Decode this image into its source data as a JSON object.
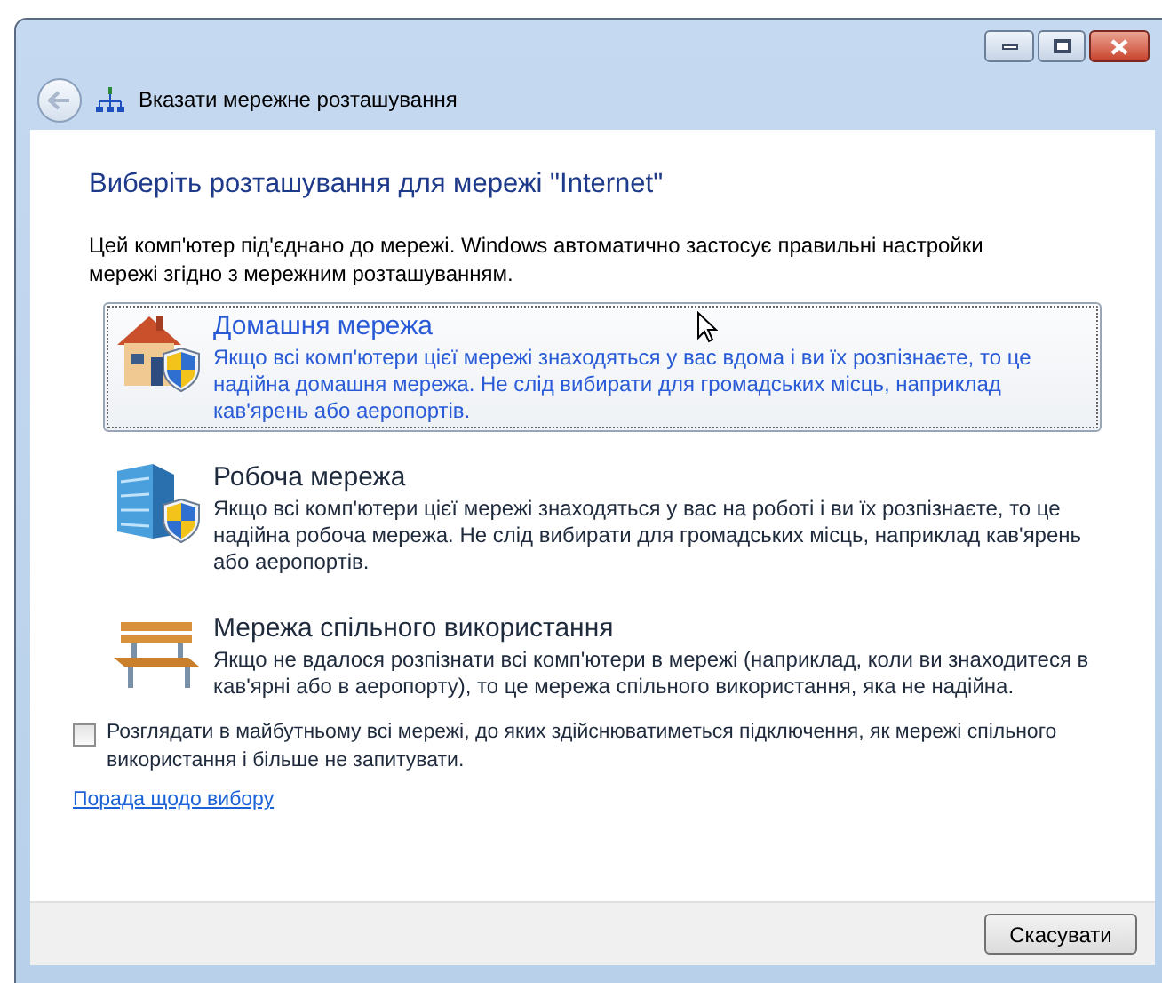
{
  "window": {
    "title": "Вказати мережне розташування"
  },
  "heading": "Виберіть розташування для мережі \"Internet\"",
  "intro": "Цей комп'ютер під'єднано до мережі. Windows автоматично застосує правильні настройки мережі згідно з мережним розташуванням.",
  "options": [
    {
      "kind": "home",
      "title": "Домашня мережа",
      "description": "Якщо всі комп'ютери цієї мережі знаходяться у вас вдома і ви їх розпізнаєте, то це надійна домашня мережа. Не слід вибирати для громадських місць, наприклад кав'ярень або аеропортів.",
      "selected": true
    },
    {
      "kind": "work",
      "title": "Робоча мережа",
      "description": "Якщо всі комп'ютери цієї мережі знаходяться у вас на роботі і ви їх розпізнаєте, то це надійна робоча мережа. Не слід вибирати для громадських місць, наприклад кав'ярень або аеропортів.",
      "selected": false
    },
    {
      "kind": "public",
      "title": "Мережа спільного використання",
      "description": "Якщо не вдалося розпізнати всі комп'ютери в мережі (наприклад, коли ви знаходитеся в кав'ярні або в аеропорту), то це мережа спільного використання, яка не надійна.",
      "selected": false
    }
  ],
  "checkbox": {
    "label": "Розглядати в майбутньому всі мережі, до яких здійснюватиметься підключення, як мережі спільного використання і більше не запитувати.",
    "checked": false
  },
  "help_link": "Порада щодо вибору",
  "buttons": [
    "Скасувати"
  ]
}
